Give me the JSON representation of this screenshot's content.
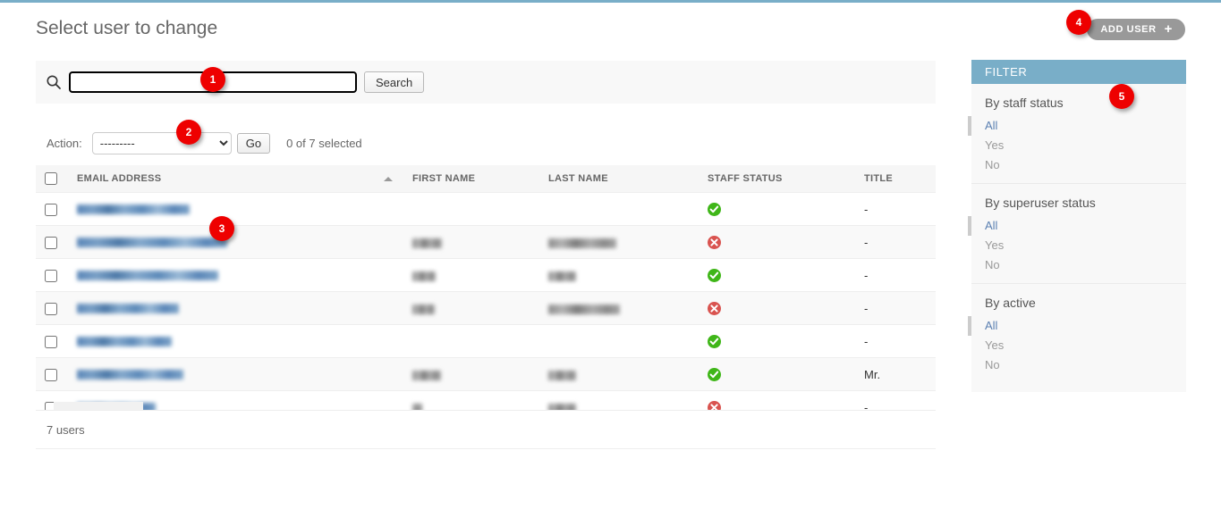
{
  "page": {
    "title": "Select user to change"
  },
  "object_tools": {
    "add_label": "ADD USER",
    "add_icon": "plus-icon",
    "plus_glyph": "+"
  },
  "search": {
    "icon": "search-icon",
    "value": "",
    "placeholder": "",
    "submit_label": "Search"
  },
  "actions": {
    "label": "Action:",
    "selected_option": "---------",
    "options": [
      "---------"
    ],
    "go_label": "Go",
    "counter": "0 of 7 selected"
  },
  "changelist": {
    "columns": [
      {
        "key": "select_all",
        "label": "",
        "type": "checkbox"
      },
      {
        "key": "email",
        "label": "EMAIL ADDRESS",
        "sorted": "asc"
      },
      {
        "key": "first_name",
        "label": "FIRST NAME",
        "sorted": ""
      },
      {
        "key": "last_name",
        "label": "LAST NAME",
        "sorted": ""
      },
      {
        "key": "staff_status",
        "label": "STAFF STATUS",
        "sorted": ""
      },
      {
        "key": "title",
        "label": "TITLE",
        "sorted": ""
      }
    ],
    "rows": [
      {
        "email_redacted_width": 126,
        "first_name_redacted_width": 0,
        "last_name_redacted_width": 0,
        "staff_status": "yes",
        "title": "-"
      },
      {
        "email_redacted_width": 168,
        "first_name_redacted_width": 33,
        "last_name_redacted_width": 76,
        "staff_status": "no",
        "title": "-"
      },
      {
        "email_redacted_width": 158,
        "first_name_redacted_width": 26,
        "last_name_redacted_width": 31,
        "staff_status": "yes",
        "title": "-"
      },
      {
        "email_redacted_width": 114,
        "first_name_redacted_width": 25,
        "last_name_redacted_width": 80,
        "staff_status": "no",
        "title": "-"
      },
      {
        "email_redacted_width": 106,
        "first_name_redacted_width": 0,
        "last_name_redacted_width": 0,
        "staff_status": "yes",
        "title": "-"
      },
      {
        "email_redacted_width": 119,
        "first_name_redacted_width": 32,
        "last_name_redacted_width": 31,
        "staff_status": "yes",
        "title": "Mr."
      },
      {
        "email_redacted_width": 88,
        "first_name_redacted_width": 11,
        "last_name_redacted_width": 31,
        "staff_status": "no",
        "title": "-"
      }
    ],
    "result_count": "7 users",
    "staff_status_icons": {
      "yes": "check-circle-icon",
      "no": "x-circle-icon"
    }
  },
  "filter": {
    "header": "FILTER",
    "groups": [
      {
        "title": "By staff status",
        "options": [
          {
            "label": "All",
            "selected": true
          },
          {
            "label": "Yes",
            "selected": false
          },
          {
            "label": "No",
            "selected": false
          }
        ]
      },
      {
        "title": "By superuser status",
        "options": [
          {
            "label": "All",
            "selected": true
          },
          {
            "label": "Yes",
            "selected": false
          },
          {
            "label": "No",
            "selected": false
          }
        ]
      },
      {
        "title": "By active",
        "options": [
          {
            "label": "All",
            "selected": true
          },
          {
            "label": "Yes",
            "selected": false
          },
          {
            "label": "No",
            "selected": false
          }
        ]
      }
    ]
  },
  "markers": [
    {
      "id": 1,
      "label": "1",
      "target": "search-input"
    },
    {
      "id": 2,
      "label": "2",
      "target": "action-select"
    },
    {
      "id": 3,
      "label": "3",
      "target": "email-link-row-2"
    },
    {
      "id": 4,
      "label": "4",
      "target": "add-user-button"
    },
    {
      "id": 5,
      "label": "5",
      "target": "filter-sidebar"
    }
  ],
  "colors": {
    "accent_blue": "#79aec8",
    "status_yes": "#3fb618",
    "status_no": "#d9534f",
    "marker_red": "#ee0000",
    "button_gray": "#999999"
  }
}
